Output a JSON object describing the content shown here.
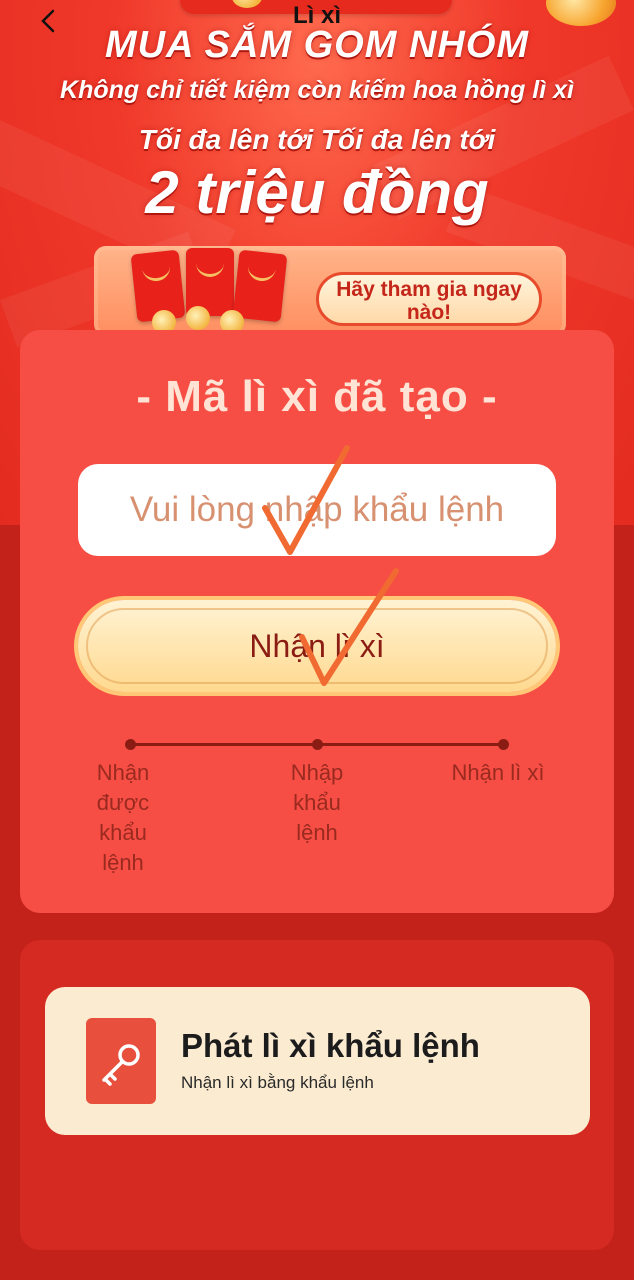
{
  "header": {
    "title": "Lì xì",
    "back_icon": "chevron-left-icon"
  },
  "hero": {
    "line1": "MUA SẮM GOM NHÓM",
    "line2": "Không chỉ tiết kiệm còn kiếm hoa hồng lì xì",
    "line3": "Tối đa lên tới Tối đa lên tới",
    "line4": "2 triệu đồng",
    "banner_button": "Hãy tham gia ngay nào!"
  },
  "redeem": {
    "title": "- Mã lì xì đã tạo -",
    "input_placeholder": "Vui lòng nhập khẩu lệnh",
    "button_label": "Nhận lì xì",
    "steps": [
      {
        "label": "Nhận được khẩu lệnh"
      },
      {
        "label": "Nhập khẩu lệnh"
      },
      {
        "label": "Nhận lì xì"
      }
    ]
  },
  "promo": {
    "title": "Phát lì xì khẩu lệnh",
    "subtitle": "Nhận lì xì bằng khẩu lệnh",
    "icon": "key-icon"
  },
  "colors": {
    "hero_red": "#e32b20",
    "card_red": "#f64e44",
    "button_gold": "#ffd98f",
    "check_orange": "#f06a32"
  }
}
